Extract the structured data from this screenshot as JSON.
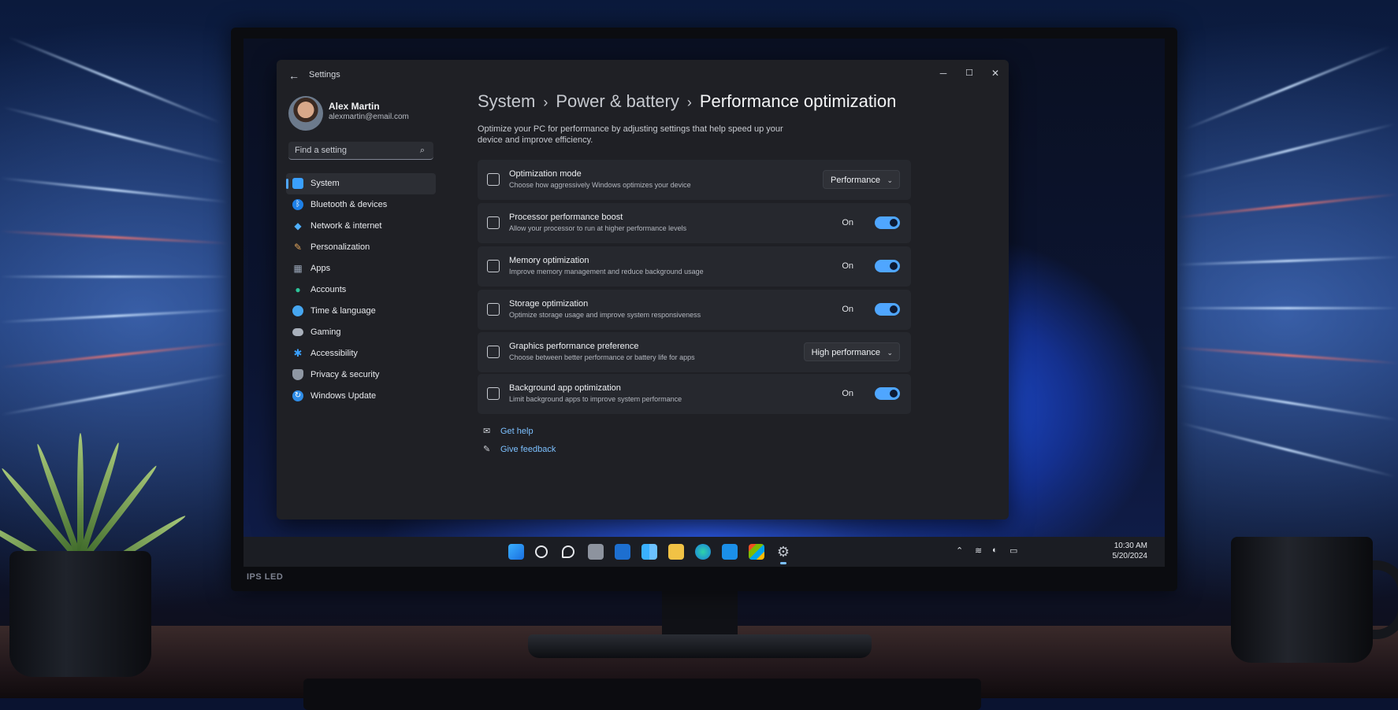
{
  "window": {
    "app_title": "Settings",
    "controls": {
      "minimize": "─",
      "maximize": "☐",
      "close": "✕"
    }
  },
  "user": {
    "name": "Alex Martin",
    "email": "alexmartin@email.com"
  },
  "search": {
    "placeholder": "Find a setting"
  },
  "nav": {
    "items": [
      {
        "label": "System",
        "icon": "system-icon",
        "color": "#3aa0ff",
        "active": true
      },
      {
        "label": "Bluetooth & devices",
        "icon": "bluetooth-icon",
        "color": "#1d7fe6"
      },
      {
        "label": "Network & internet",
        "icon": "wifi-icon",
        "color": "#4fb0ff"
      },
      {
        "label": "Personalization",
        "icon": "brush-icon",
        "color": "#e2a55c"
      },
      {
        "label": "Apps",
        "icon": "apps-icon",
        "color": "#9aa6b8"
      },
      {
        "label": "Accounts",
        "icon": "account-icon",
        "color": "#2dc49a"
      },
      {
        "label": "Time & language",
        "icon": "globe-clock-icon",
        "color": "#46a6f0"
      },
      {
        "label": "Gaming",
        "icon": "gamepad-icon",
        "color": "#a9b0bb"
      },
      {
        "label": "Accessibility",
        "icon": "accessibility-icon",
        "color": "#3aa0ff"
      },
      {
        "label": "Privacy & security",
        "icon": "shield-icon",
        "color": "#8f97a3"
      },
      {
        "label": "Windows Update",
        "icon": "update-icon",
        "color": "#2f8de8"
      }
    ]
  },
  "breadcrumb": {
    "level1": "System",
    "level2": "Power & battery",
    "current": "Performance optimization",
    "sep": "›"
  },
  "description": "Optimize your PC for performance by adjusting settings that help speed up your device and improve efficiency.",
  "settings": [
    {
      "title": "Optimization mode",
      "subtitle": "Choose how aggressively Windows optimizes your device",
      "control": "dropdown",
      "value": "Performance",
      "icon": "optimization-icon"
    },
    {
      "title": "Processor performance boost",
      "subtitle": "Allow your processor to run at higher performance levels",
      "control": "toggle",
      "value": "On",
      "icon": "processor-icon"
    },
    {
      "title": "Memory optimization",
      "subtitle": "Improve memory management and reduce background usage",
      "control": "toggle",
      "value": "On",
      "icon": "memory-icon"
    },
    {
      "title": "Storage optimization",
      "subtitle": "Optimize storage usage and improve system responsiveness",
      "control": "toggle",
      "value": "On",
      "icon": "storage-icon"
    },
    {
      "title": "Graphics performance preference",
      "subtitle": "Choose between better performance or battery life for apps",
      "control": "dropdown",
      "value": "High performance",
      "icon": "graphics-icon"
    },
    {
      "title": "Background app optimization",
      "subtitle": "Limit background apps to improve system performance",
      "control": "toggle",
      "value": "On",
      "icon": "background-apps-icon"
    }
  ],
  "links": {
    "help": "Get help",
    "feedback": "Give feedback"
  },
  "taskbar": {
    "icons": [
      "start-icon",
      "search-icon",
      "chat-icon",
      "task-view-icon",
      "outlook-icon",
      "widgets-icon",
      "file-explorer-icon",
      "edge-icon",
      "store-alt-icon",
      "microsoft-store-icon",
      "settings-icon"
    ],
    "clock_time": "10:30 AM",
    "clock_date": "5/20/2024"
  },
  "monitor": {
    "brand_label": "IPS LED"
  },
  "colors": {
    "accent": "#4fa6ff",
    "link": "#7cc0ff",
    "window_bg": "#1f2025",
    "card_bg": "#26282e"
  }
}
